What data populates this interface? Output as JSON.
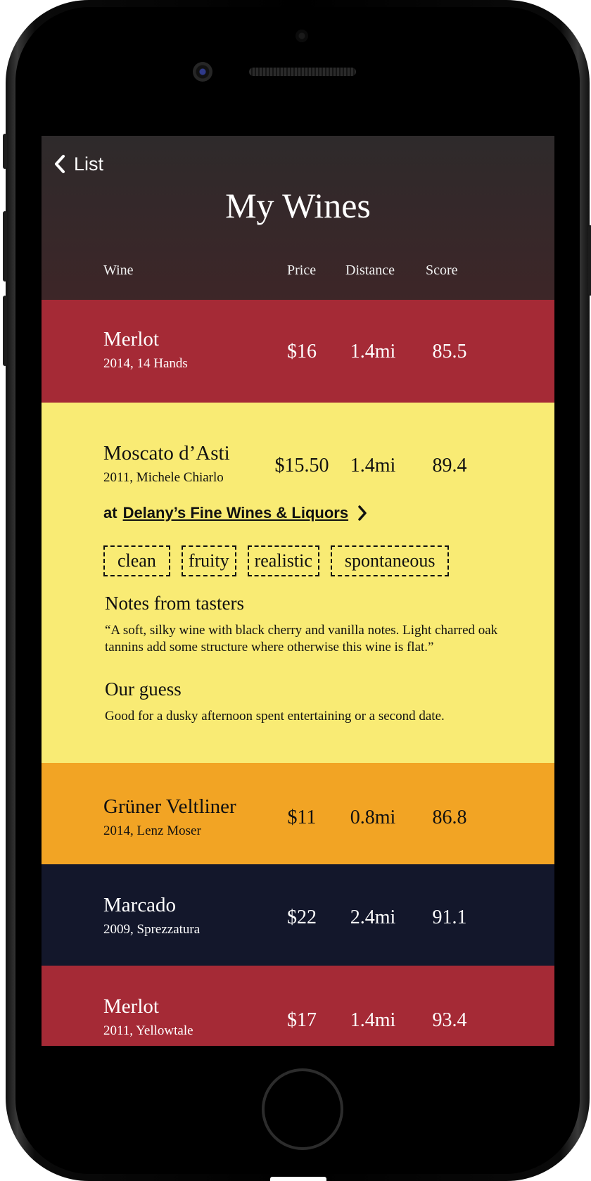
{
  "header": {
    "back_label": "List",
    "title": "My Wines",
    "columns": {
      "wine": "Wine",
      "price": "Price",
      "distance": "Distance",
      "score": "Score"
    }
  },
  "wines": [
    {
      "name": "Merlot",
      "sub": "2014, 14 Hands",
      "price": "$16",
      "distance": "1.4mi",
      "score": "85.5",
      "color": "#a52a36"
    },
    {
      "name": "Moscato d’Asti",
      "sub": "2011, Michele Chiarlo",
      "price": "$15.50",
      "distance": "1.4mi",
      "score": "89.4",
      "color": "#f9eb74",
      "expanded": {
        "at_prefix": "at",
        "store": "Delany’s Fine Wines & Liquors",
        "tags": [
          "clean",
          "fruity",
          "realistic",
          "spontaneous"
        ],
        "notes_heading": "Notes from tasters",
        "notes_text": "“A soft, silky wine with black cherry and vanilla notes. Light charred oak tannins add some structure where otherwise this wine is flat.”",
        "guess_heading": "Our guess",
        "guess_text": "Good for a dusky afternoon spent entertaining or a second date."
      }
    },
    {
      "name": "Grüner Veltliner",
      "sub": "2014, Lenz Moser",
      "price": "$11",
      "distance": "0.8mi",
      "score": "86.8",
      "color": "#f2a424"
    },
    {
      "name": "Marcado",
      "sub": "2009, Sprezzatura",
      "price": "$22",
      "distance": "2.4mi",
      "score": "91.1",
      "color": "#13172b"
    },
    {
      "name": "Merlot",
      "sub": "2011, Yellowtale",
      "price": "$17",
      "distance": "1.4mi",
      "score": "93.4",
      "color": "#a52a36"
    }
  ],
  "icons": {
    "back": "chevron-left-icon",
    "store_link": "chevron-right-icon"
  }
}
